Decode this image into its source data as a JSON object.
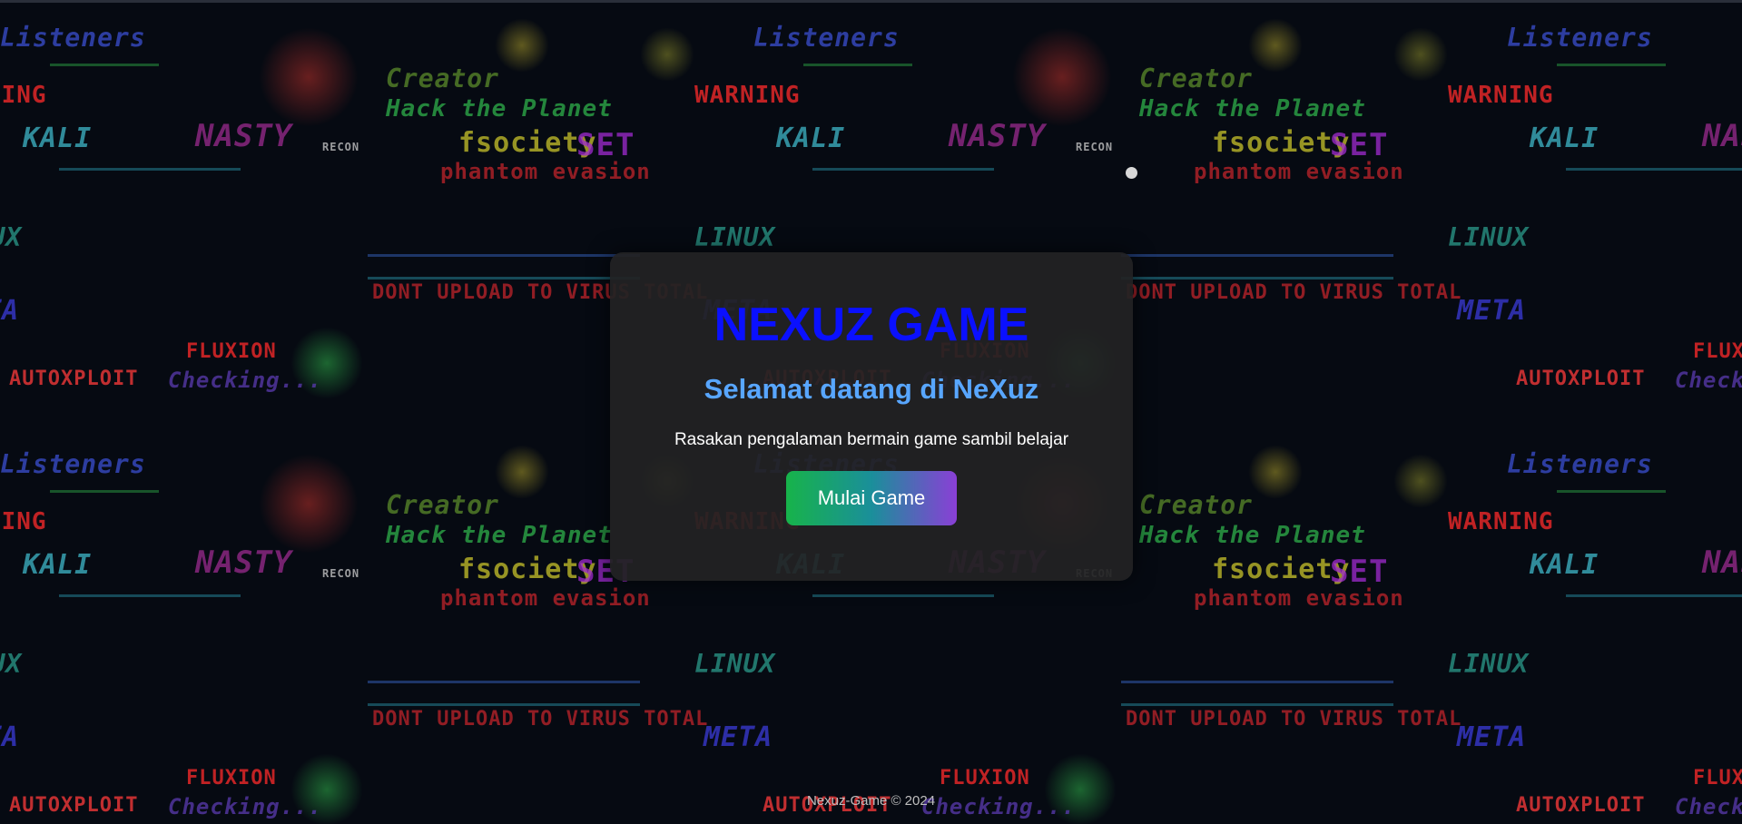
{
  "card": {
    "title": "NEXUZ GAME",
    "subtitle": "Selamat datang di NeXuz",
    "description": "Rasakan pengalaman bermain game sambil belajar",
    "start_button_label": "Mulai Game"
  },
  "footer": {
    "text": "Nexuz-Game © 2024"
  },
  "colors": {
    "title": "#0a10ff",
    "subtitle": "#58a6ff",
    "button_gradient_start": "#17b34a",
    "button_gradient_end": "#8a3fd6",
    "card_background": "#222224",
    "page_background": "#060a12"
  },
  "background": {
    "words": [
      "WARNING",
      "KALI",
      "NASTY",
      "fsociety",
      "SET",
      "Hack the Planet",
      "AUTOXPLOIT",
      "FLUXION",
      "Listeners",
      "Creator",
      "phantom evasion",
      "LINUX",
      "META",
      "Checking...",
      "RECON",
      "DONT UPLOAD TO VIRUS TOTAL"
    ]
  }
}
